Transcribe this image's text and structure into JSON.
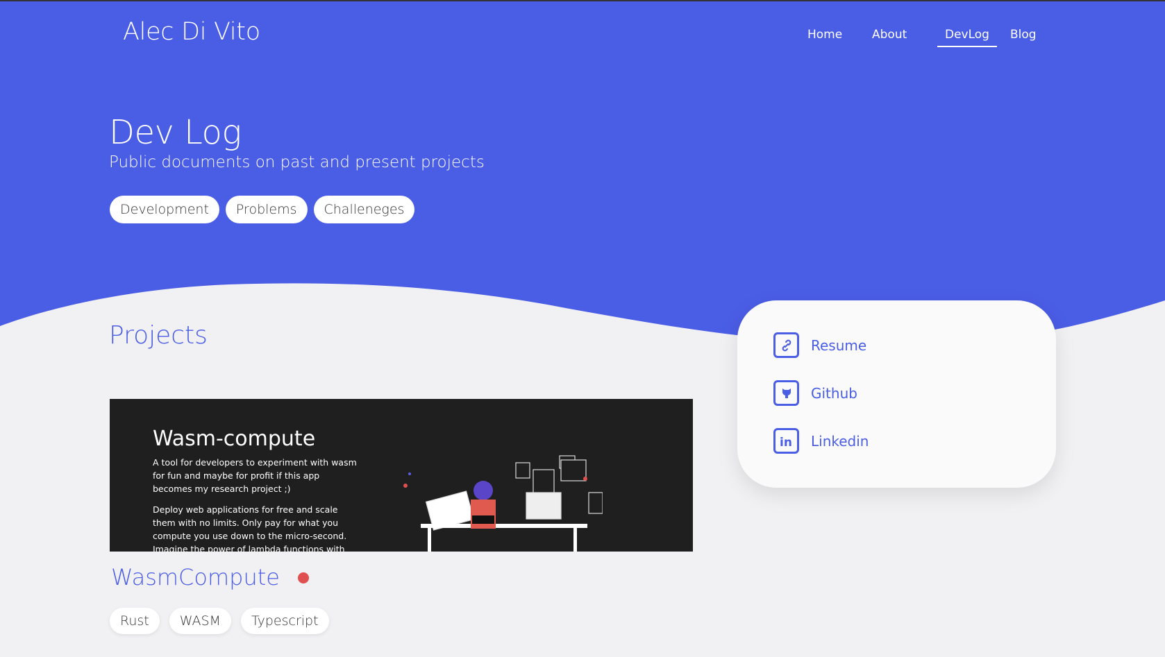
{
  "header": {
    "brand": "Alec Di Vito",
    "nav": [
      {
        "label": "Home"
      },
      {
        "label": "About"
      },
      {
        "label": "DevLog",
        "active": true
      },
      {
        "label": "Blog"
      }
    ]
  },
  "hero": {
    "title": "Dev Log",
    "subtitle": "Public documents on past and present projects",
    "filters": [
      "Development",
      "Problems",
      "Challeneges"
    ]
  },
  "projects": {
    "section_title": "Projects",
    "items": [
      {
        "name": "WasmCompute",
        "status_color": "#e05050",
        "image": {
          "title": "Wasm-compute",
          "paragraph1": "A tool for developers to experiment with wasm for fun and maybe for profit if this app becomes my research project ;)",
          "paragraph2": "Deploy web applications for free and scale them with no limits. Only pay for what you compute you use down to the micro-second. Imagine the power of lambda functions with the ability to fine"
        },
        "tags": [
          "Rust",
          "WASM",
          "Typescript"
        ]
      }
    ]
  },
  "links": [
    {
      "label": "Resume",
      "icon": "link-icon"
    },
    {
      "label": "Github",
      "icon": "github-icon"
    },
    {
      "label": "Linkedin",
      "icon": "linkedin-icon"
    }
  ],
  "colors": {
    "brand": "#4a5de5",
    "background": "#f1f1f3",
    "status_dot": "#e05050"
  }
}
